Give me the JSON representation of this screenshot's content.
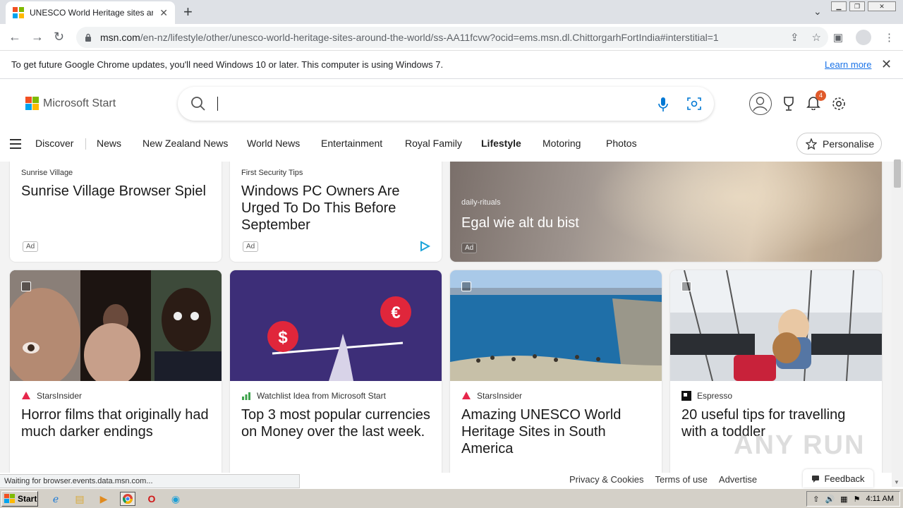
{
  "browser": {
    "tab_title": "UNESCO World Heritage sites around the world",
    "new_tab": "+",
    "url_host": "msn.com",
    "url_path": "/en-nz/lifestyle/other/unesco-world-heritage-sites-around-the-world/ss-AA11fcvw?ocid=ems.msn.dl.ChittorgarhFortIndia#interstitial=1"
  },
  "infobar": {
    "message": "To get future Google Chrome updates, you'll need Windows 10 or later. This computer is using Windows 7.",
    "learn_more": "Learn more"
  },
  "msn": {
    "brand": "Microsoft Start",
    "search_placeholder": "",
    "notification_count": "4",
    "nav": [
      "Discover",
      "News",
      "New Zealand News",
      "World News",
      "Entertainment",
      "Royal Family",
      "Lifestyle",
      "Motoring",
      "Photos"
    ],
    "active_nav": "Lifestyle",
    "personalise": "Personalise"
  },
  "ads": [
    {
      "source": "Sunrise Village",
      "title": "Sunrise Village Browser Spiel",
      "tag": "Ad"
    },
    {
      "source": "First Security Tips",
      "title": "Windows PC Owners Are Urged To Do This Before September",
      "tag": "Ad"
    },
    {
      "source": "daily-rituals",
      "title": "Egal wie alt du bist",
      "tag": "Ad"
    }
  ],
  "cards": [
    {
      "source": "StarsInsider",
      "title": "Horror films that originally had much darker endings"
    },
    {
      "source": "Watchlist Idea from Microsoft Start",
      "title": "Top 3 most popular currencies on Money over the last week."
    },
    {
      "source": "StarsInsider",
      "title": "Amazing UNESCO World Heritage Sites in South America"
    },
    {
      "source": "Espresso",
      "title": "20 useful tips for travelling with a toddler"
    }
  ],
  "footer": {
    "privacy": "Privacy & Cookies",
    "terms": "Terms of use",
    "advertise": "Advertise",
    "feedback": "Feedback"
  },
  "status": "Waiting for browser.events.data.msn.com...",
  "watermark": "ANY RUN",
  "taskbar": {
    "start": "Start",
    "time": "4:11 AM"
  },
  "colors": {
    "accent": "#0078d4",
    "badge": "#e05a2b",
    "currency_bg": "#3d2e78"
  }
}
